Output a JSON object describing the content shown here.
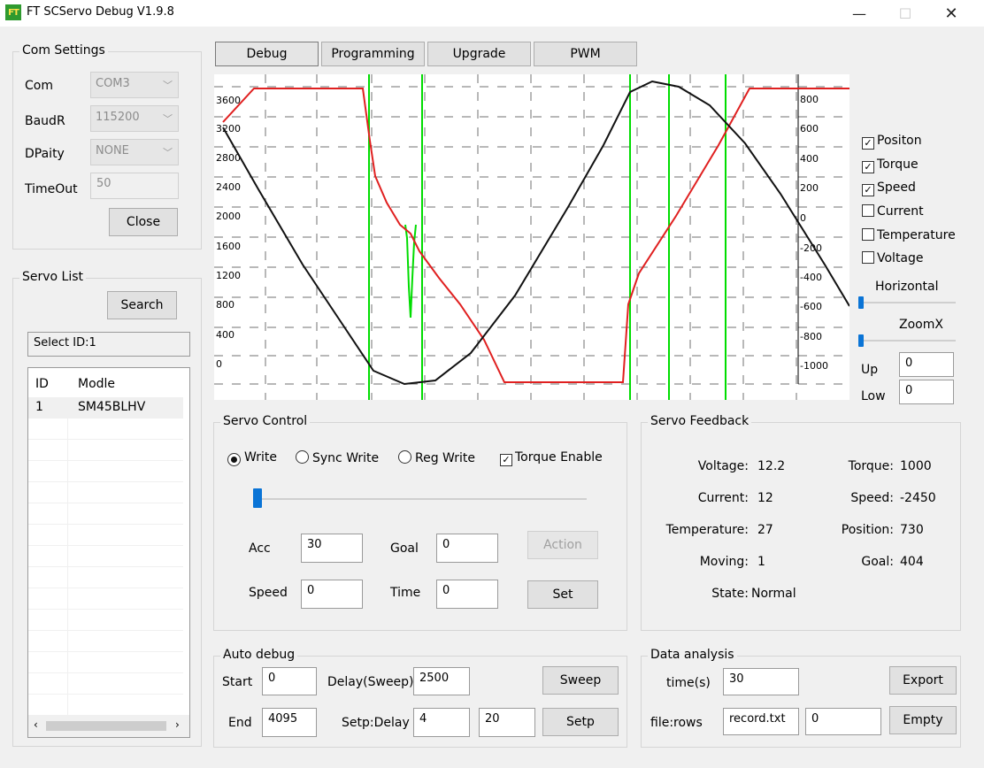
{
  "window": {
    "icon_text": "FT",
    "title": "FT SCServo Debug V1.9.8",
    "minimize": "—",
    "maximize": "☐",
    "close": "✕"
  },
  "com_settings": {
    "title": "Com Settings",
    "com_label": "Com",
    "com_value": "COM3",
    "baud_label": "BaudR",
    "baud_value": "115200",
    "parity_label": "DPaity",
    "parity_value": "NONE",
    "timeout_label": "TimeOut",
    "timeout_value": "50",
    "close_button": "Close"
  },
  "servo_list": {
    "title": "Servo List",
    "search_button": "Search",
    "select_id": "Select ID:1",
    "columns": [
      "ID",
      "Modle"
    ],
    "rows": [
      [
        "1",
        "SM45BLHV"
      ]
    ]
  },
  "tabs": [
    "Debug",
    "Programming",
    "Upgrade",
    "PWM"
  ],
  "chart": {
    "left_ticks": [
      "3600",
      "3200",
      "2800",
      "2400",
      "2000",
      "1600",
      "1200",
      "800",
      "400",
      "0"
    ],
    "right_ticks": [
      "800",
      "600",
      "400",
      "200",
      "0",
      "-200",
      "-400",
      "-600",
      "-800",
      "-1000"
    ],
    "colors": {
      "position": "#000000",
      "torque": "#00dd00",
      "speed": "#e02020"
    }
  },
  "chart_data": {
    "type": "line",
    "y_left_ticks": [
      3600,
      3200,
      2800,
      2400,
      2000,
      1600,
      1200,
      800,
      400,
      0
    ],
    "y_right_ticks": [
      800,
      600,
      400,
      200,
      0,
      -200,
      -400,
      -600,
      -800,
      -1000
    ],
    "series": [
      {
        "name": "Positon",
        "color": "#000000"
      },
      {
        "name": "Torque",
        "color": "#00dd00"
      },
      {
        "name": "Speed",
        "color": "#e02020"
      }
    ]
  },
  "channels": {
    "items": [
      {
        "label": "Positon",
        "checked": true
      },
      {
        "label": "Torque",
        "checked": true
      },
      {
        "label": "Speed",
        "checked": true
      },
      {
        "label": "Current",
        "checked": false
      },
      {
        "label": "Temperature",
        "checked": false
      },
      {
        "label": "Voltage",
        "checked": false
      }
    ],
    "horizontal_label": "Horizontal",
    "zoomx_label": "ZoomX",
    "up_label": "Up",
    "up_value": "0",
    "low_label": "Low",
    "low_value": "0",
    "check_glyph": "✓"
  },
  "servo_control": {
    "title": "Servo Control",
    "write": "Write",
    "sync_write": "Sync Write",
    "reg_write": "Reg Write",
    "torque_enable": "Torque Enable",
    "acc_label": "Acc",
    "acc_value": "30",
    "goal_label": "Goal",
    "goal_value": "0",
    "speed_label": "Speed",
    "speed_value": "0",
    "time_label": "Time",
    "time_value": "0",
    "action_button": "Action",
    "set_button": "Set"
  },
  "servo_feedback": {
    "title": "Servo Feedback",
    "voltage_label": "Voltage:",
    "voltage": "12.2",
    "current_label": "Current:",
    "current": "12",
    "temperature_label": "Temperature:",
    "temperature": "27",
    "moving_label": "Moving:",
    "moving": "1",
    "state_label": "State:",
    "state": "Normal",
    "torque_label": "Torque:",
    "torque": "1000",
    "speed_label": "Speed:",
    "speed": "-2450",
    "position_label": "Position:",
    "position": "730",
    "goal_label": "Goal:",
    "goal": "404"
  },
  "auto_debug": {
    "title": "Auto debug",
    "start_label": "Start",
    "start_value": "0",
    "delay_sweep_label": "Delay(Sweep)",
    "delay_sweep_value": "2500",
    "sweep_button": "Sweep",
    "end_label": "End",
    "end_value": "4095",
    "step_delay_label": "Setp:Delay",
    "step_value": "4",
    "delay_value": "20",
    "step_button": "Setp"
  },
  "data_analysis": {
    "title": "Data analysis",
    "time_label": "time(s)",
    "time_value": "30",
    "export_button": "Export",
    "file_label": "file:rows",
    "file_value": "record.txt",
    "rows_value": "0",
    "empty_button": "Empty"
  }
}
